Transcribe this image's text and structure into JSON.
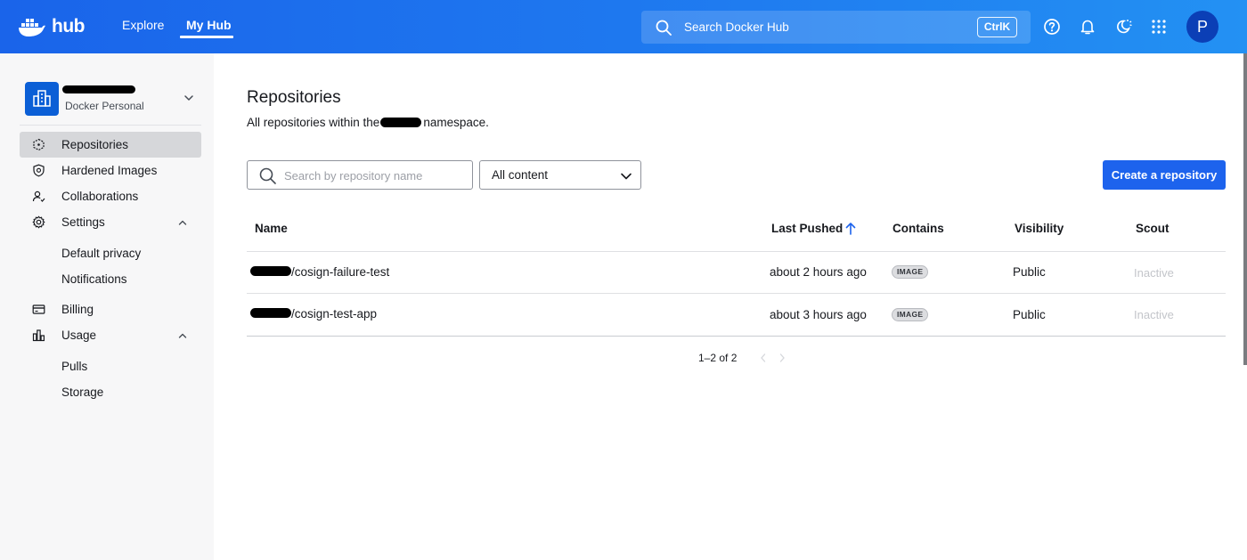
{
  "topbar": {
    "logo_text": "hub",
    "nav": [
      {
        "label": "Explore"
      },
      {
        "label": "My Hub"
      }
    ],
    "search_placeholder": "Search Docker Hub",
    "search_shortcut": "CtrlK",
    "avatar_initial": "P"
  },
  "sidebar": {
    "org_subtitle": "Docker Personal",
    "items": [
      {
        "label": "Repositories",
        "icon": "cube-icon",
        "active": true
      },
      {
        "label": "Hardened Images",
        "icon": "shield-icon"
      },
      {
        "label": "Collaborations",
        "icon": "people-icon"
      },
      {
        "label": "Settings",
        "icon": "gear-icon",
        "expanded": true
      },
      {
        "label": "Billing",
        "icon": "card-icon"
      },
      {
        "label": "Usage",
        "icon": "bar-chart-icon",
        "expanded": true
      }
    ],
    "settings_sub": [
      "Default privacy",
      "Notifications"
    ],
    "usage_sub": [
      "Pulls",
      "Storage"
    ]
  },
  "main": {
    "title": "Repositories",
    "subtitle_before": "All repositories within the",
    "subtitle_after": "namespace.",
    "search_placeholder": "Search by repository name",
    "content_filter": "All content",
    "create_button": "Create a repository",
    "table": {
      "headers": [
        "Name",
        "Last Pushed",
        "Contains",
        "Visibility",
        "Scout"
      ],
      "rows": [
        {
          "name": "/cosign-failure-test",
          "last_pushed": "about 2 hours ago",
          "contains": "IMAGE",
          "visibility": "Public",
          "scout": "Inactive"
        },
        {
          "name": "/cosign-test-app",
          "last_pushed": "about 3 hours ago",
          "contains": "IMAGE",
          "visibility": "Public",
          "scout": "Inactive"
        }
      ]
    },
    "pagination": "1–2 of 2"
  },
  "colors": {
    "brand_blue": "#1d63ed",
    "avatar_bg": "#0b3fb6",
    "active_item_bg": "#d6d7da"
  }
}
